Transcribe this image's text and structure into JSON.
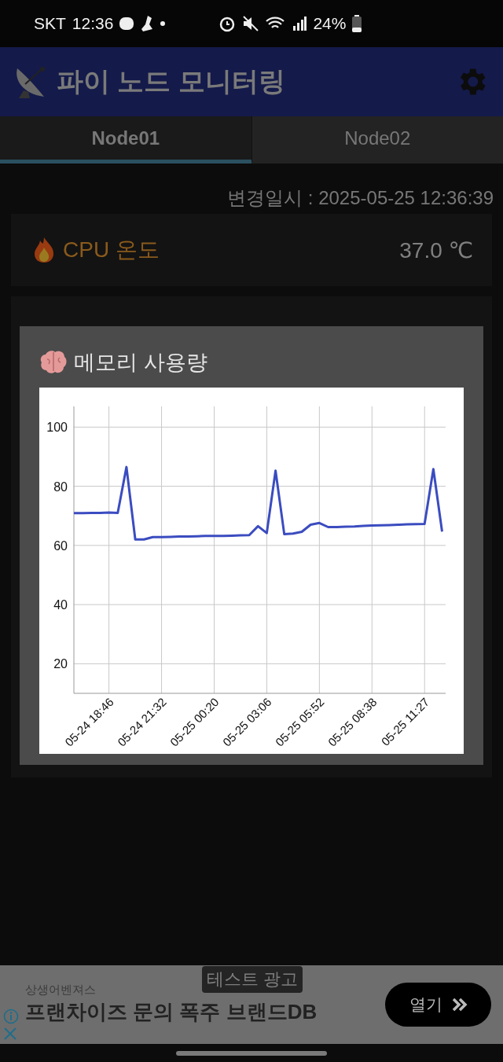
{
  "status_bar": {
    "carrier": "SKT",
    "time": "12:36",
    "battery": "24%"
  },
  "app_bar": {
    "title": "파이 노드 모니터링"
  },
  "tabs": [
    {
      "label": "Node01",
      "selected": true
    },
    {
      "label": "Node02",
      "selected": false
    }
  ],
  "updated": "변경일시 : 2025-05-25 12:36:39",
  "cards": [
    {
      "kind": "temperature",
      "label": "CPU 온도",
      "value": "37.0 ℃"
    }
  ],
  "dialog": {
    "title": "메모리 사용량",
    "chart_data": {
      "type": "line",
      "categories": [
        null,
        null,
        null,
        null,
        "05-24 18:46",
        null,
        null,
        null,
        null,
        null,
        "05-24 21:32",
        null,
        null,
        null,
        null,
        null,
        "05-25 00:20",
        null,
        null,
        null,
        null,
        null,
        "05-25 03:06",
        null,
        null,
        null,
        null,
        null,
        "05-25 05:52",
        null,
        null,
        null,
        null,
        null,
        "05-25 08:38",
        null,
        null,
        null,
        null,
        null,
        "05-25 11:27",
        null,
        null
      ],
      "series": [
        {
          "color": "#3b4cc0",
          "values": [
            70.9,
            70.9,
            71.0,
            71.0,
            71.1,
            71.0,
            86.5,
            62.0,
            62.0,
            62.8,
            62.8,
            62.9,
            63.0,
            63.0,
            63.1,
            63.2,
            63.2,
            63.2,
            63.3,
            63.4,
            63.5,
            66.5,
            64.2,
            85.3,
            63.8,
            64.0,
            64.6,
            67.0,
            67.6,
            66.2,
            66.2,
            66.3,
            66.4,
            66.6,
            66.7,
            66.8,
            66.9,
            67.0,
            67.1,
            67.2,
            67.3,
            85.8,
            64.7
          ]
        }
      ],
      "ylim": [
        10,
        107
      ],
      "grid": true,
      "yticks": [
        20,
        40,
        60,
        80,
        100
      ]
    }
  },
  "ad": {
    "badge": "테스트 광고",
    "advertiser": "상생어벤져스",
    "headline": "프랜차이즈 문의 폭주 브랜드DB",
    "button": "열기"
  }
}
